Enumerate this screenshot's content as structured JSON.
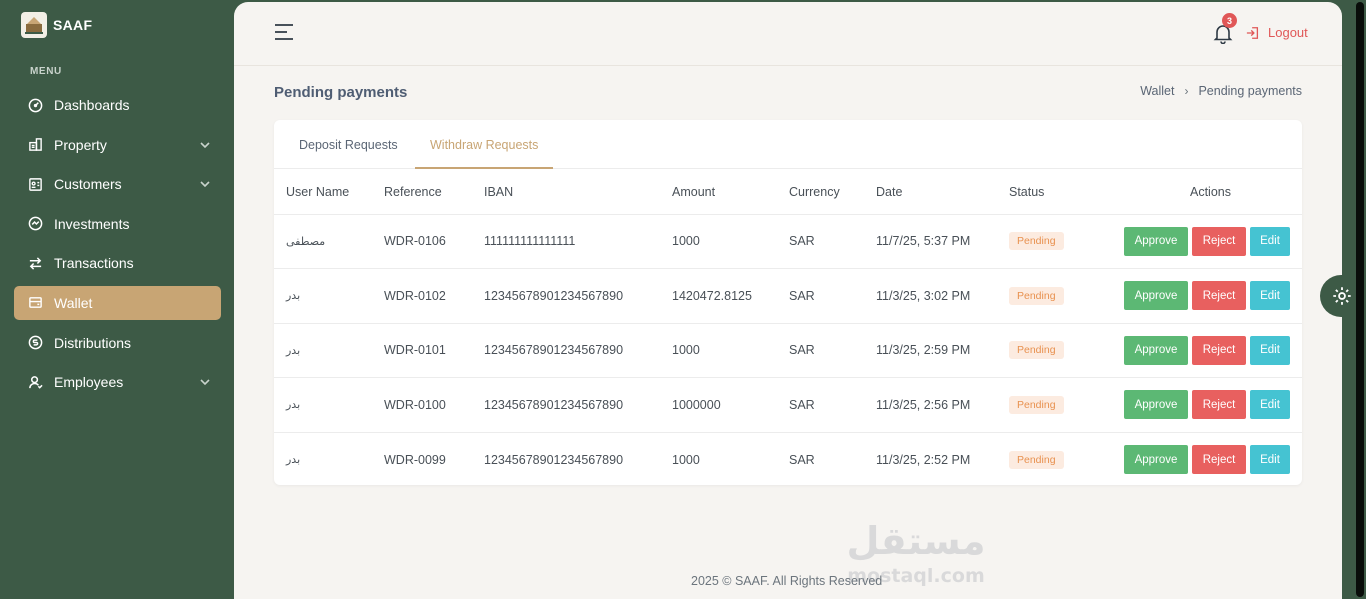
{
  "brand": {
    "name": "SAAF"
  },
  "sidebar": {
    "heading": "MENU",
    "items": [
      {
        "label": "Dashboards",
        "icon": "dashboard-icon",
        "has_chevron": false,
        "active": false
      },
      {
        "label": "Property",
        "icon": "property-icon",
        "has_chevron": true,
        "active": false
      },
      {
        "label": "Customers",
        "icon": "customers-icon",
        "has_chevron": true,
        "active": false
      },
      {
        "label": "Investments",
        "icon": "investments-icon",
        "has_chevron": false,
        "active": false
      },
      {
        "label": "Transactions",
        "icon": "transactions-icon",
        "has_chevron": false,
        "active": false
      },
      {
        "label": "Wallet",
        "icon": "wallet-icon",
        "has_chevron": false,
        "active": true
      },
      {
        "label": "Distributions",
        "icon": "distributions-icon",
        "has_chevron": false,
        "active": false
      },
      {
        "label": "Employees",
        "icon": "employees-icon",
        "has_chevron": true,
        "active": false
      }
    ]
  },
  "topbar": {
    "notification_count": "3",
    "logout_label": "Logout"
  },
  "page": {
    "title": "Pending payments",
    "breadcrumb": [
      "Wallet",
      "Pending payments"
    ]
  },
  "tabs": [
    {
      "label": "Deposit Requests",
      "active": false
    },
    {
      "label": "Withdraw Requests",
      "active": true
    }
  ],
  "table": {
    "columns": [
      "User Name",
      "Reference",
      "IBAN",
      "Amount",
      "Currency",
      "Date",
      "Status",
      "Actions"
    ],
    "rows": [
      {
        "user": "مصطفى",
        "reference": "WDR-0106",
        "iban": "111111111111111",
        "amount": "1000",
        "currency": "SAR",
        "date": "11/7/25, 5:37 PM",
        "status": "Pending"
      },
      {
        "user": "بدر",
        "reference": "WDR-0102",
        "iban": "12345678901234567890",
        "amount": "1420472.8125",
        "currency": "SAR",
        "date": "11/3/25, 3:02 PM",
        "status": "Pending"
      },
      {
        "user": "بدر",
        "reference": "WDR-0101",
        "iban": "12345678901234567890",
        "amount": "1000",
        "currency": "SAR",
        "date": "11/3/25, 2:59 PM",
        "status": "Pending"
      },
      {
        "user": "بدر",
        "reference": "WDR-0100",
        "iban": "12345678901234567890",
        "amount": "1000000",
        "currency": "SAR",
        "date": "11/3/25, 2:56 PM",
        "status": "Pending"
      },
      {
        "user": "بدر",
        "reference": "WDR-0099",
        "iban": "12345678901234567890",
        "amount": "1000",
        "currency": "SAR",
        "date": "11/3/25, 2:52 PM",
        "status": "Pending"
      }
    ],
    "actions": {
      "approve": "Approve",
      "reject": "Reject",
      "edit": "Edit"
    }
  },
  "footer": {
    "text": "2025 © SAAF. All Rights Reserved"
  },
  "watermark": {
    "text_ar": "مستقل",
    "text_en": "mostaql.com"
  },
  "colors": {
    "sidebar": "#3d5a46",
    "accent": "#c8a574",
    "approve": "#5cb874",
    "reject": "#e8605f",
    "edit": "#45c3d2",
    "pending_bg": "#fcebe0",
    "pending_text": "#e8914f",
    "danger": "#e05757"
  }
}
